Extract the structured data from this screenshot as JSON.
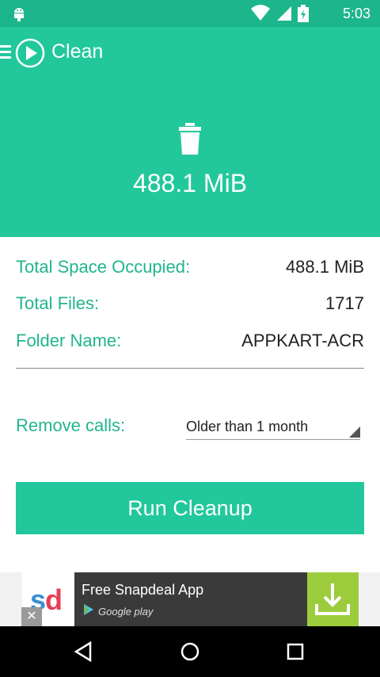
{
  "status_bar": {
    "time": "5:03"
  },
  "app_bar": {
    "title": "Clean"
  },
  "hero": {
    "size": "488.1 MiB"
  },
  "info": {
    "rows": [
      {
        "label": "Total Space Occupied:",
        "value": "488.1 MiB"
      },
      {
        "label": "Total Files:",
        "value": "1717"
      },
      {
        "label": "Folder Name:",
        "value": "APPKART-ACR"
      }
    ]
  },
  "remove_calls": {
    "label": "Remove calls:",
    "selected": "Older than 1 month"
  },
  "run_button": {
    "label": "Run Cleanup"
  },
  "ad": {
    "logo_s": "s",
    "logo_d": "d",
    "title": "Free Snapdeal App",
    "store": "Google play",
    "close": "✕"
  },
  "colors": {
    "accent": "#22c89b",
    "status": "#1db58c",
    "label": "#22b58c"
  }
}
